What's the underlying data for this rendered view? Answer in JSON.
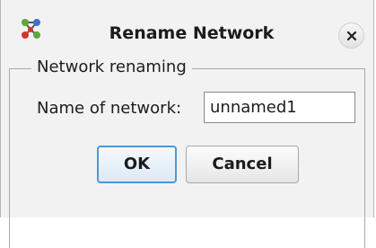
{
  "dialog": {
    "title": "Rename Network",
    "app_icon": "network-nodes-icon",
    "close_icon": "close-icon"
  },
  "group": {
    "legend": "Network renaming"
  },
  "form": {
    "name_label": "Name of network:",
    "name_value": "unnamed1"
  },
  "buttons": {
    "ok_label": "OK",
    "cancel_label": "Cancel"
  },
  "colors": {
    "focus_border": "#4d98d8",
    "icon_green": "#5aa83a",
    "icon_red": "#d9342b",
    "icon_blue": "#3b6fd0"
  }
}
